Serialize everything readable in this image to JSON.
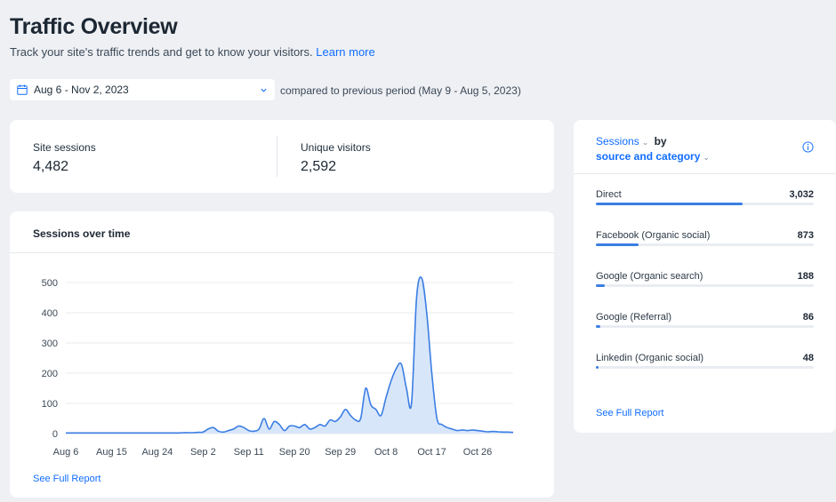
{
  "header": {
    "title": "Traffic Overview",
    "subtitle": "Track your site's traffic trends and get to know your visitors.",
    "learn_more": "Learn more"
  },
  "filters": {
    "date_range": "Aug 6 - Nov 2, 2023",
    "comparison": "compared to previous period (May 9 - Aug 5, 2023)",
    "calendar_icon": "calendar-icon",
    "dropdown_icon": "chevron-down-icon"
  },
  "kpis": [
    {
      "label": "Site sessions",
      "value": "4,482"
    },
    {
      "label": "Unique visitors",
      "value": "2,592"
    }
  ],
  "sessions_chart": {
    "heading": "Sessions over time",
    "footer_link": "See Full Report"
  },
  "chart_data": {
    "type": "area",
    "title": "Sessions over time",
    "xlabel": "",
    "ylabel": "",
    "ylim": [
      0,
      500
    ],
    "yticks": [
      0,
      100,
      200,
      300,
      400,
      500
    ],
    "xticks": [
      "Aug 6",
      "Aug 15",
      "Aug 24",
      "Sep 2",
      "Sep 11",
      "Sep 20",
      "Sep 29",
      "Oct 8",
      "Oct 17",
      "Oct 26"
    ],
    "grid": true,
    "color": "#3b7ee3",
    "fill": "#d8e6fa",
    "x_start": "Aug 6",
    "x_end": "Nov 2",
    "values": [
      2,
      2,
      2,
      2,
      2,
      2,
      2,
      2,
      2,
      2,
      2,
      2,
      2,
      2,
      2,
      2,
      2,
      2,
      2,
      2,
      2,
      2,
      2,
      3,
      3,
      3,
      4,
      5,
      15,
      20,
      8,
      5,
      10,
      15,
      25,
      20,
      10,
      8,
      15,
      50,
      15,
      40,
      30,
      10,
      25,
      25,
      20,
      30,
      15,
      20,
      30,
      25,
      45,
      40,
      55,
      80,
      60,
      45,
      50,
      150,
      95,
      80,
      60,
      120,
      175,
      215,
      230,
      150,
      100,
      450,
      515,
      400,
      200,
      50,
      30,
      20,
      15,
      10,
      12,
      10,
      12,
      10,
      8,
      6,
      7,
      6,
      5,
      5,
      4
    ]
  },
  "sources_panel": {
    "metric_label": "Sessions",
    "by_label": "by",
    "dimension_label": "source and category",
    "info_icon": "info-icon",
    "rows": [
      {
        "label": "Direct",
        "value": "3,032",
        "share": 0.675
      },
      {
        "label": "Facebook (Organic social)",
        "value": "873",
        "share": 0.195
      },
      {
        "label": "Google (Organic search)",
        "value": "188",
        "share": 0.042
      },
      {
        "label": "Google (Referral)",
        "value": "86",
        "share": 0.019
      },
      {
        "label": "Linkedin (Organic social)",
        "value": "48",
        "share": 0.011
      }
    ],
    "footer_link": "See Full Report"
  }
}
